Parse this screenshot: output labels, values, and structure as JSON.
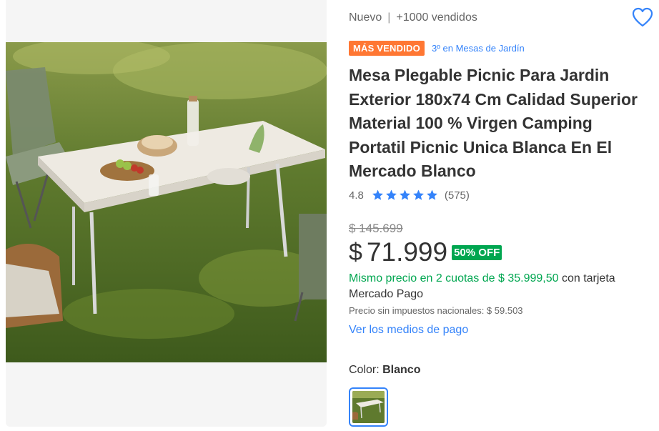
{
  "product": {
    "condition": "Nuevo",
    "separator": "|",
    "sold": "+1000 vendidos",
    "badge_best_seller": "MÁS VENDIDO",
    "rank_text": "3º en Mesas de Jardín",
    "title": "Mesa Plegable Picnic Para Jardin Exterior 180x74 Cm Calidad Superior Material 100 % Virgen Camping Portatil Picnic Unica Blanca En El Mercado Blanco",
    "favorite_icon": "heart-outline-icon"
  },
  "rating": {
    "value": "4.8",
    "stars": 5,
    "count": "(575)",
    "star_color": "#3483fa"
  },
  "price": {
    "original": "$ 145.699",
    "currency_symbol": "$",
    "current": "71.999",
    "discount": "50% OFF",
    "installments_green": "Mismo precio en 2 cuotas de $ 35.999,50",
    "installments_rest": " con tarjeta Mercado Pago",
    "taxes": "Precio sin impuestos nacionales: $ 59.503",
    "payment_link": "Ver los medios de pago"
  },
  "variant": {
    "label": "Color: ",
    "selected": "Blanco"
  },
  "colors": {
    "accent_blue": "#3483fa",
    "green": "#00a650",
    "orange_badge": "#ff7733"
  }
}
